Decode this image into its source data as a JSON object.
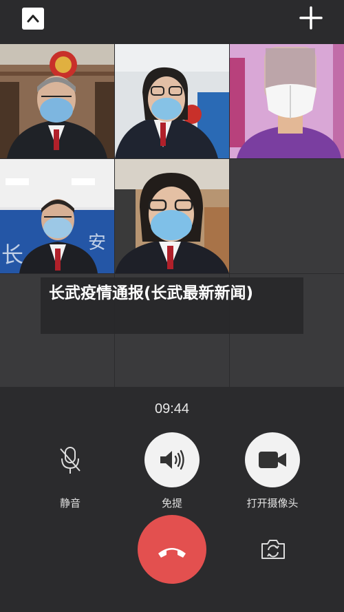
{
  "title": "长武疫情通报(长武最新新闻)",
  "call": {
    "timer": "09:44",
    "controls": {
      "mute_label": "静音",
      "speaker_label": "免提",
      "camera_label": "打开摄像头"
    }
  },
  "icons": {
    "collapse": "chevron-up-icon",
    "add": "plus-icon",
    "mute": "microphone-off-icon",
    "speaker": "speaker-icon",
    "camera": "video-camera-icon",
    "hangup": "phone-hangup-icon",
    "switch_camera": "camera-switch-icon"
  },
  "colors": {
    "background": "#2b2b2d",
    "hangup": "#e3504f",
    "control": "#f2f2f2"
  }
}
